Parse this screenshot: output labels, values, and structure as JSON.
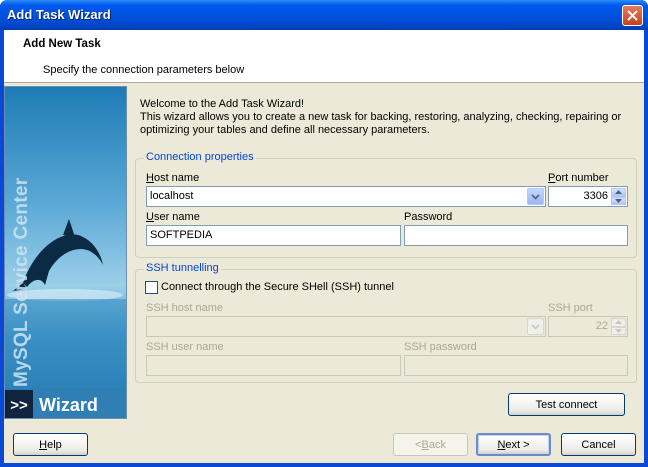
{
  "window": {
    "title": "Add Task Wizard"
  },
  "header": {
    "title": "Add New Task",
    "subtitle": "Specify the connection parameters below"
  },
  "sidebar": {
    "vertical_text": "MySQL Service Center",
    "arrows": ">>",
    "wizard_label": "Wizard"
  },
  "intro": {
    "line1": "Welcome to the Add Task Wizard!",
    "line2": "This wizard allows you to create a new task for backing, restoring, analyzing, checking, repairing or",
    "line3": "optimizing your tables and define all necessary parameters."
  },
  "connection": {
    "legend": "Connection properties",
    "host_label": "Host name",
    "host_value": "localhost",
    "port_label": "Port number",
    "port_value": "3306",
    "user_label": "User name",
    "user_value": "SOFTPEDIA",
    "password_label": "Password",
    "password_value": ""
  },
  "ssh": {
    "legend": "SSH tunnelling",
    "checkbox_label": "Connect through the Secure SHell (SSH) tunnel",
    "checked": false,
    "host_label": "SSH host name",
    "host_value": "",
    "port_label": "SSH port",
    "port_value": "22",
    "user_label": "SSH user name",
    "user_value": "",
    "password_label": "SSH password",
    "password_value": ""
  },
  "buttons": {
    "test_connect": "Test connect",
    "help": "Help",
    "back": "< Back",
    "next": "Next >",
    "cancel": "Cancel"
  },
  "colors": {
    "title_bar": "#0054e3",
    "group_legend": "#0046d5",
    "dialog_bg": "#ece9d8",
    "disabled_text": "#aca899"
  }
}
